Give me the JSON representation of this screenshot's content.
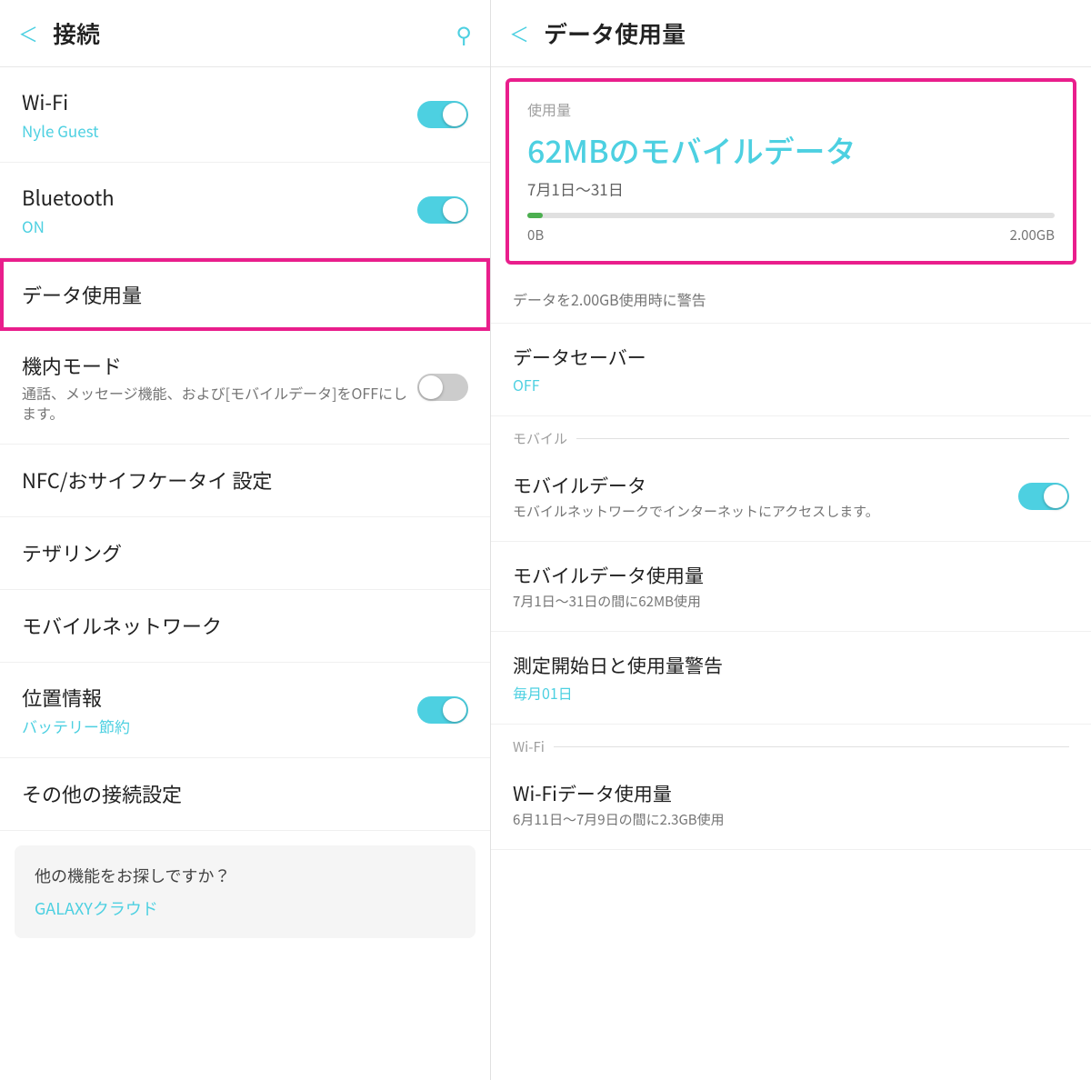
{
  "left": {
    "header": {
      "back_label": "＜",
      "title": "接続",
      "search_icon": "🔍"
    },
    "items": [
      {
        "id": "wifi",
        "title": "Wi-Fi",
        "subtitle": "Nyle Guest",
        "toggle": true,
        "toggle_state": "on"
      },
      {
        "id": "bluetooth",
        "title": "Bluetooth",
        "subtitle": "ON",
        "toggle": true,
        "toggle_state": "on"
      },
      {
        "id": "data-usage",
        "title": "データ使用量",
        "highlighted": true
      },
      {
        "id": "airplane",
        "title": "機内モード",
        "desc": "通話、メッセージ機能、および[モバイルデータ]をOFFにします。",
        "toggle": true,
        "toggle_state": "off"
      },
      {
        "id": "nfc",
        "title": "NFC/おサイフケータイ 設定"
      },
      {
        "id": "tethering",
        "title": "テザリング"
      },
      {
        "id": "mobile-network",
        "title": "モバイルネットワーク"
      },
      {
        "id": "location",
        "title": "位置情報",
        "subtitle": "バッテリー節約",
        "toggle": true,
        "toggle_state": "on"
      },
      {
        "id": "other",
        "title": "その他の接続設定"
      }
    ],
    "bottom_card": {
      "title": "他の機能をお探しですか？",
      "link": "GALAXYクラウド"
    }
  },
  "right": {
    "header": {
      "back_label": "＜",
      "title": "データ使用量"
    },
    "usage_card": {
      "section_label": "使用量",
      "amount": "62MBのモバイルデータ",
      "period": "7月1日〜31日",
      "progress_fill_percent": 3,
      "label_min": "0B",
      "label_max": "2.00GB"
    },
    "warning": "データを2.00GB使用時に警告",
    "items": [
      {
        "id": "data-saver",
        "title": "データセーバー",
        "subtitle": "OFF"
      },
      {
        "section": "モバイル"
      },
      {
        "id": "mobile-data",
        "title": "モバイルデータ",
        "desc": "モバイルネットワークでインターネットにアクセスします。",
        "toggle": true,
        "toggle_state": "on"
      },
      {
        "id": "mobile-data-usage",
        "title": "モバイルデータ使用量",
        "desc": "7月1日〜31日の間に62MB使用"
      },
      {
        "id": "billing-cycle",
        "title": "測定開始日と使用量警告",
        "subtitle": "毎月01日"
      },
      {
        "section": "Wi-Fi"
      },
      {
        "id": "wifi-data-usage",
        "title": "Wi-Fiデータ使用量",
        "desc": "6月11日〜7月9日の間に2.3GB使用"
      }
    ]
  }
}
